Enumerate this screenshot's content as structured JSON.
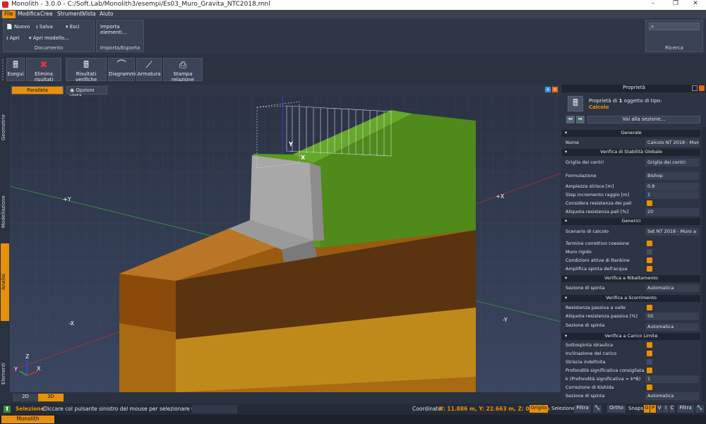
{
  "window": {
    "title": "Monolith - 3.0.0 - C:/Soft.Lab/Monolith3/esempi/Es03_Muro_Gravita_NTC2018.mnl",
    "minimize": "–",
    "maximize": "❐",
    "close": "✕"
  },
  "menu": [
    "File",
    "Modifica",
    "Crea",
    "Strumenti",
    "Vista",
    "Aiuto"
  ],
  "ribbon": {
    "documento": {
      "label": "Documento",
      "nuovo": "Nuovo",
      "salva": "Salva",
      "esci": "Esci",
      "apri": "Apri",
      "apri_modello": "Apri modello..."
    },
    "importa": {
      "label": "Importa/Esporta",
      "importa_elementi": "Importa elementi..."
    },
    "ricerca": {
      "label": "Ricerca"
    }
  },
  "toolbar": [
    "Esegui",
    "Elimina risultati",
    "Risultati verifiche",
    "Diagrammi",
    "Armatura",
    "Stampa relazione"
  ],
  "left_tabs": [
    "Geometrie",
    "Modellazione",
    "Analisi",
    "Elementi"
  ],
  "view": {
    "parallela": "Parallela",
    "opzioni": "Opzioni vista...",
    "tab2d": "2D",
    "tab3d": "3D",
    "axes": {
      "y_pos": "+Y",
      "x_pos": "+X",
      "x_neg": "-X",
      "y_neg": "-Y",
      "y": "Y",
      "x": "X"
    },
    "triad": {
      "z": "Z",
      "y": "Y",
      "x": "X"
    }
  },
  "props": {
    "panel_title": "Proprietà",
    "header_prefix": "Proprietà di ",
    "header_count": "1",
    "header_suffix": " oggetto di tipo:",
    "type": "Calcolo",
    "goto": "Vai alla sezione...",
    "sections": {
      "generale": "Generale",
      "stabilita": "Verifica di Stabilità Globale",
      "generici": "Generici",
      "ribaltamento": "Verifica a Ribaltamento",
      "scorrimento": "Verifica a Scorrimento",
      "carico": "Verifica a Carico Limite"
    },
    "rows": {
      "nome": {
        "l": "Nome",
        "v": "Calcolo NT 2018 - Muro a g"
      },
      "griglia": {
        "l": "Griglia dei centri",
        "v": "Griglia dei centri"
      },
      "formulazione": {
        "l": "Formulazione",
        "v": "Bishop"
      },
      "ampiezza": {
        "l": "Ampiezza strisce [m]",
        "v": "0.8"
      },
      "step": {
        "l": "Step incremento raggio [m]",
        "v": "1"
      },
      "considera": {
        "l": "Considera resistenza dei pali"
      },
      "aliquota_pali": {
        "l": "Aliquota resistenza pali [%]",
        "v": "20"
      },
      "scenario": {
        "l": "Scenario di calcolo",
        "v": "Set NT 2018 - Muro a"
      },
      "termine": {
        "l": "Termine correttivo coesione"
      },
      "muro": {
        "l": "Muro rigido"
      },
      "rankine": {
        "l": "Condizioni attive di Rankine"
      },
      "amplifica": {
        "l": "Amplifica spinta dell'acqua"
      },
      "sez_rib": {
        "l": "Sezione di spinta",
        "v": "Automatica"
      },
      "resistenza": {
        "l": "Resistenza passiva a valle"
      },
      "aliquota_pass": {
        "l": "Aliquota resistenza passiva [%]",
        "v": "50"
      },
      "sez_sco": {
        "l": "Sezione di spinta",
        "v": "Automatica"
      },
      "sottospinta": {
        "l": "Sottospinta idraulica"
      },
      "inclinazione": {
        "l": "Inclinazione del carico"
      },
      "striscia": {
        "l": "Striscia indefinita"
      },
      "profondita": {
        "l": "Profondità significativa consigliata"
      },
      "k": {
        "l": "k (Profondità significativa = k*B)",
        "v": "1"
      },
      "kishida": {
        "l": "Correzione di Kishida"
      },
      "sez_car": {
        "l": "Sezione di spinta",
        "v": "Automatica"
      }
    }
  },
  "status": {
    "sel_label": "Selezione:",
    "sel_text": "Cliccare col pulsante sinistro del mouse per selezionare un oggetto",
    "coord_label": "Coordinate:",
    "coord_value": "X: 11.886 m, Y: 22.663 m, Z: 0.000 m",
    "griglia": "Griglia",
    "selezione": "Selezione:",
    "filtra": "Filtra",
    "ortho": "Ortho",
    "snaps": "Snaps:",
    "snap_g": "G",
    "snap_p": "P",
    "snap_v": "V",
    "snap_i": "I",
    "snap_c": "C",
    "filtra2": "Filtra"
  },
  "taskbar": {
    "app": "Monolith"
  },
  "colors": {
    "accent": "#e8900a",
    "green": "#5a9a1e",
    "gray": "#a8a8a8"
  }
}
